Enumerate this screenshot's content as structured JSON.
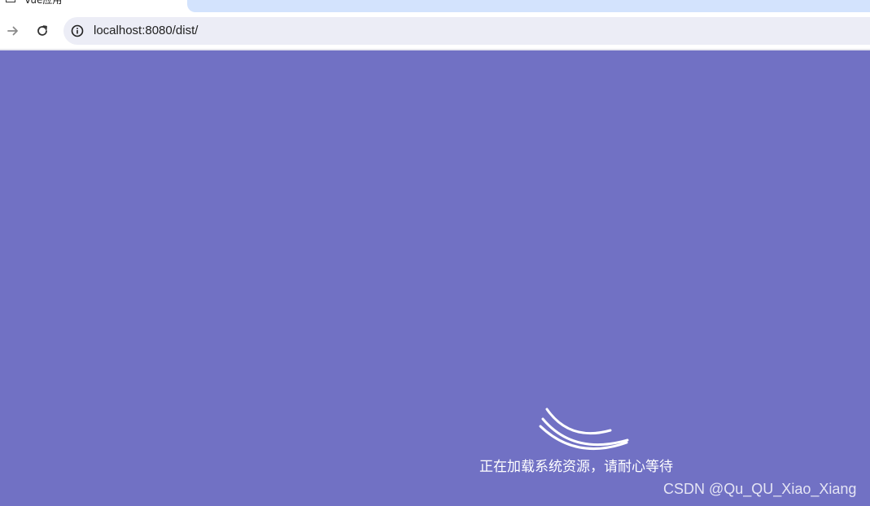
{
  "browser": {
    "tab_title": "Vue应用",
    "address_bar": {
      "url": "localhost:8080/dist/"
    },
    "icons": {
      "forward": "arrow-right-icon",
      "reload": "reload-icon",
      "site_info": "info-icon"
    }
  },
  "page": {
    "background_color": "#7171c4",
    "loading_message": "正在加载系统资源，请耐心等待",
    "watermark": "CSDN @Qu_QU_Xiao_Xiang"
  }
}
